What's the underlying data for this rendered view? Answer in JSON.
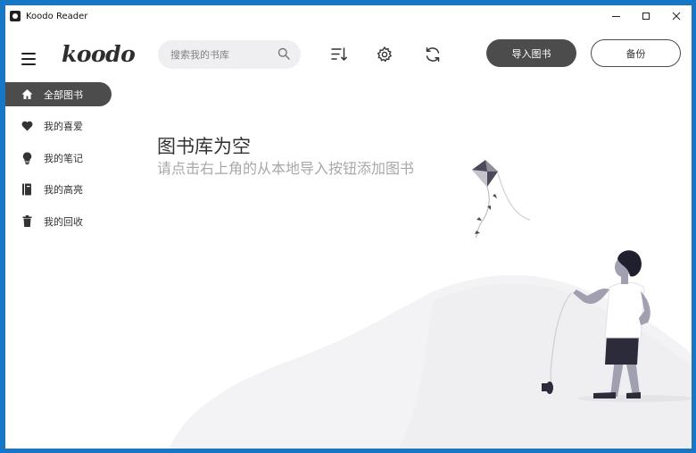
{
  "window": {
    "title": "Koodo Reader"
  },
  "header": {
    "logo": "koodo",
    "search_placeholder": "搜索我的书库",
    "import_label": "导入图书",
    "backup_label": "备份"
  },
  "sidebar": {
    "items": [
      {
        "label": "全部图书",
        "icon": "home-icon",
        "active": true
      },
      {
        "label": "我的喜爱",
        "icon": "heart-icon",
        "active": false
      },
      {
        "label": "我的笔记",
        "icon": "lightbulb-icon",
        "active": false
      },
      {
        "label": "我的高亮",
        "icon": "highlight-book-icon",
        "active": false
      },
      {
        "label": "我的回收",
        "icon": "trash-icon",
        "active": false
      }
    ]
  },
  "main": {
    "empty_title": "图书库为空",
    "empty_description": "请点击右上角的从本地导入按钮添加图书"
  },
  "colors": {
    "accent": "#4c4c4c",
    "background": "#ffffff",
    "search_bg": "#efeff1",
    "muted_text": "#a8a8a8"
  }
}
